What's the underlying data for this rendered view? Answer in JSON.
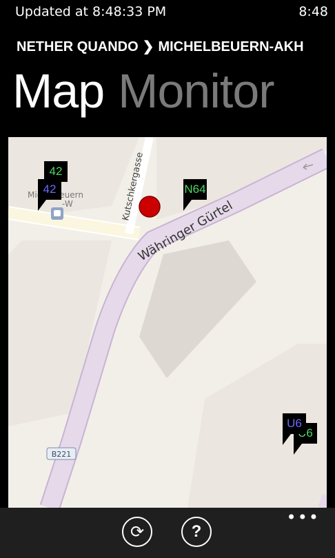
{
  "status": {
    "updated_text": "Updated at 8:48:33 PM",
    "clock": "8:48"
  },
  "breadcrumb": {
    "from": "NETHER QUANDO",
    "separator": "❯",
    "to": "MICHELBEUERN-AKH"
  },
  "pivot": {
    "active": "Map",
    "inactive": "Monitor"
  },
  "map": {
    "street_labels": {
      "kutschkergasse": "Kutschkergasse",
      "wahringer": "Währinger Gürtel",
      "place": "Michelbeuern",
      "place_suffix": "-W",
      "road_badge": "B221"
    },
    "markers": [
      {
        "label": "42",
        "color": "#4cd964"
      },
      {
        "label": "42",
        "color": "#6a6aff"
      },
      {
        "label": "N64",
        "color": "#4cd964"
      },
      {
        "label": "U6",
        "color": "#6a6aff"
      },
      {
        "label": "U6",
        "color": "#4cd964"
      }
    ],
    "user_location_color": "#cc0000"
  },
  "appbar": {
    "refresh_icon": "refresh-icon",
    "help_icon": "help-icon",
    "more_label": "•••"
  },
  "colors": {
    "background": "#000000",
    "map_background": "#f2efe9",
    "road_color": "#e5d9ea"
  }
}
